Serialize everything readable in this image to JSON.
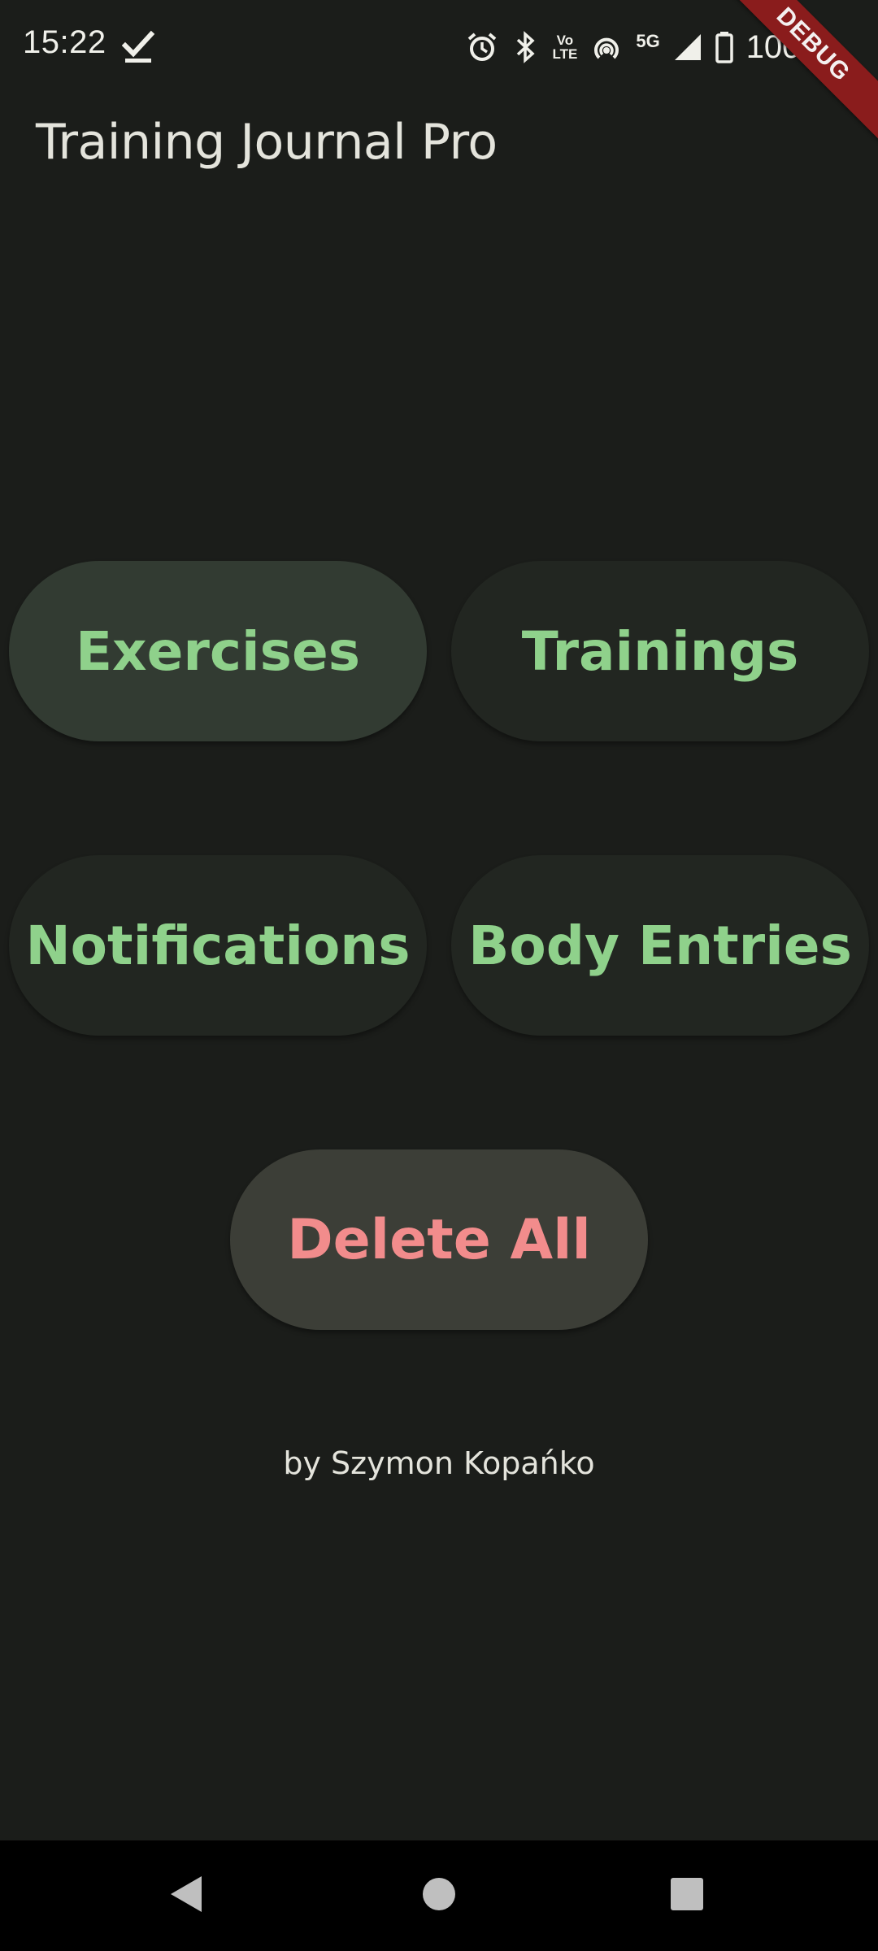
{
  "status_bar": {
    "time": "15:22",
    "network": "5G",
    "volte_top": "Vo",
    "volte_bottom": "LTE",
    "battery": "100%",
    "icons": [
      "checkmark-icon",
      "alarm-icon",
      "bluetooth-icon",
      "volte-icon",
      "hotspot-icon",
      "signal-icon",
      "battery-icon"
    ]
  },
  "debug_banner": "DEBUG",
  "app_bar": {
    "title": "Training Journal Pro"
  },
  "menu": {
    "exercises": "Exercises",
    "trainings": "Trainings",
    "notifications": "Notifications",
    "body_entries": "Body Entries",
    "delete_all": "Delete All"
  },
  "credit": "by Szymon Kopańko",
  "colors": {
    "background": "#1b1d1a",
    "accent_green": "#8fd18b",
    "danger_red": "#f28c8c",
    "debug_red": "#8a1c1c"
  },
  "nav_bar": {
    "icons": [
      "back-icon",
      "home-icon",
      "recents-icon"
    ]
  }
}
